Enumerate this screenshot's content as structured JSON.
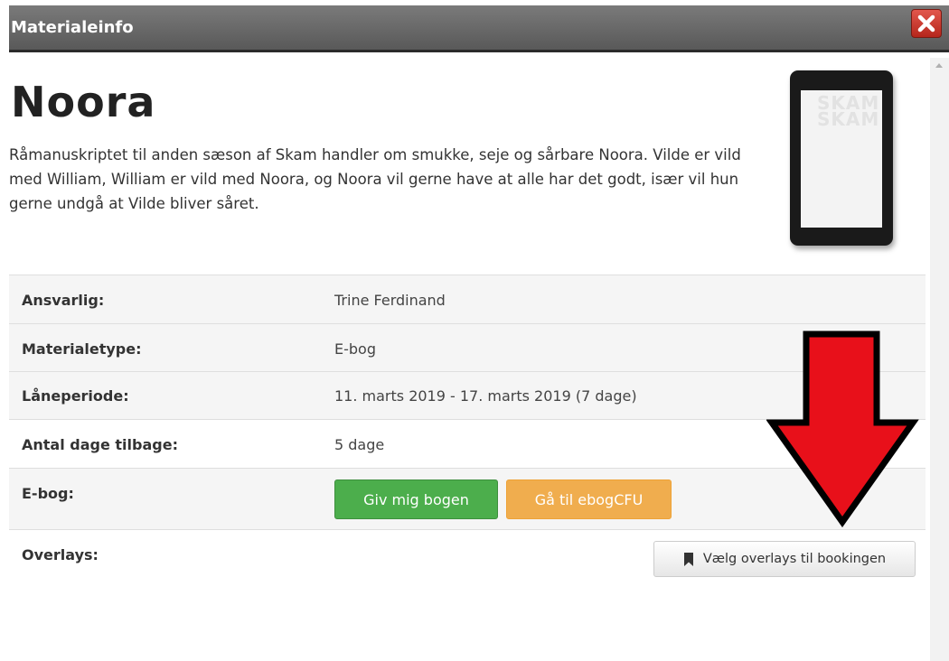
{
  "dialog": {
    "title": "Materialeinfo",
    "close_label": "✕"
  },
  "book": {
    "title": "Noora",
    "description": "Råmanuskriptet til anden sæson af Skam handler om smukke, seje og sårbare Noora. Vilde er vild med William, William er vild med Noora, og Noora vil gerne have at alle har det godt, især vil hun gerne undgå at Vilde bliver såret.",
    "cover_word": "SKAM"
  },
  "details": [
    {
      "label": "Ansvarlig:",
      "value": "Trine Ferdinand"
    },
    {
      "label": "Materialetype:",
      "value": "E-bog"
    },
    {
      "label": "Låneperiode:",
      "value": "11. marts 2019 - 17. marts 2019 (7 dage)"
    },
    {
      "label": "Antal dage tilbage:",
      "value": "5 dage"
    }
  ],
  "ebook_row": {
    "label": "E-bog:",
    "give_button": "Giv mig bogen",
    "goto_button": "Gå til ebogCFU"
  },
  "overlays_row": {
    "label": "Overlays:",
    "button": "Vælg overlays til bookingen"
  },
  "colors": {
    "green_button": "#4cae4c",
    "orange_button": "#f0ad4e",
    "arrow": "#e8101a",
    "close_button": "#c9362b"
  }
}
